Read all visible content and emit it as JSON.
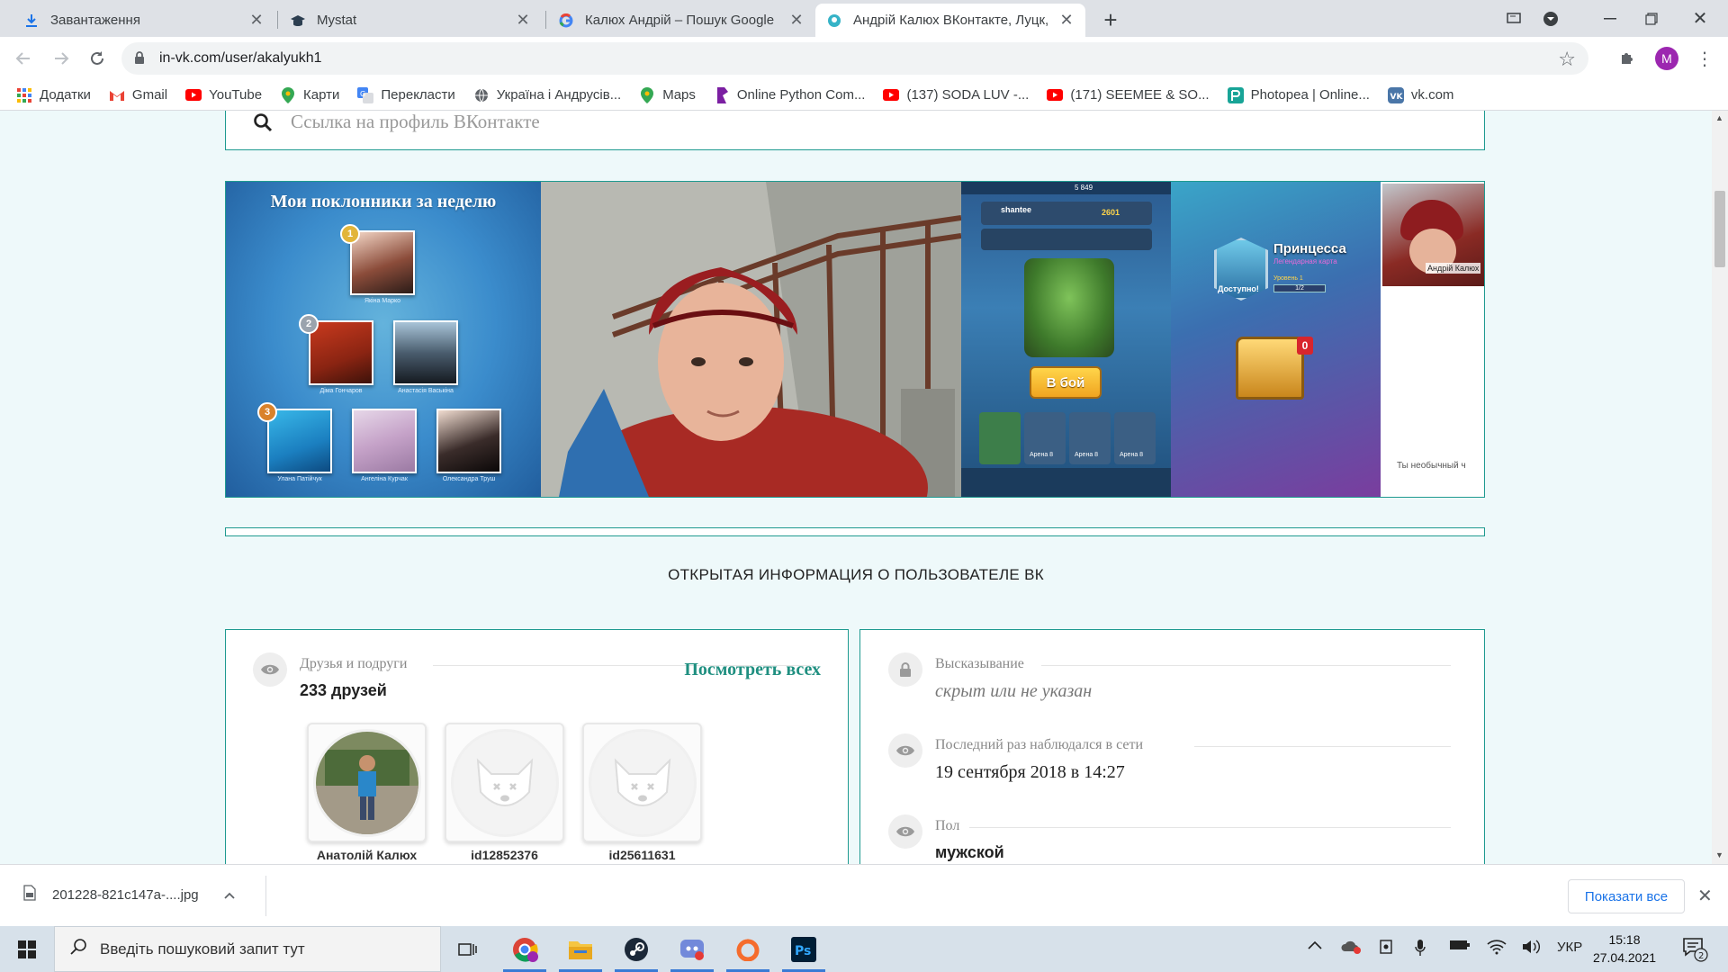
{
  "browser": {
    "tabs": [
      {
        "title": "Завантаження",
        "icon": "download-icon",
        "active": false
      },
      {
        "title": "Mystat",
        "icon": "graduation-cap-icon",
        "active": false
      },
      {
        "title": "Калюх Андрій – Пошук Google",
        "icon": "google-icon",
        "active": false
      },
      {
        "title": "Андрій Калюх ВКонтакте, Луцк,",
        "icon": "in-vk-icon",
        "active": true
      }
    ],
    "new_tab": "+",
    "url": "in-vk.com/user/akalyukh1",
    "profile_initial": "M",
    "bookmarks": [
      {
        "label": "Додатки",
        "icon": "apps-grid-icon"
      },
      {
        "label": "Gmail",
        "icon": "gmail-icon"
      },
      {
        "label": "YouTube",
        "icon": "youtube-icon"
      },
      {
        "label": "Карти",
        "icon": "maps-pin-icon"
      },
      {
        "label": "Перекласти",
        "icon": "translate-icon"
      },
      {
        "label": "Україна і Андрусів...",
        "icon": "globe-icon"
      },
      {
        "label": "Maps",
        "icon": "maps-pin-icon"
      },
      {
        "label": "Online Python Com...",
        "icon": "python-icon"
      },
      {
        "label": "(137) SODA LUV -...",
        "icon": "youtube-icon"
      },
      {
        "label": "(171) SEEMEE & SO...",
        "icon": "youtube-icon"
      },
      {
        "label": "Photopea | Online...",
        "icon": "photopea-icon"
      },
      {
        "label": "vk.com",
        "icon": "vk-icon"
      }
    ]
  },
  "page": {
    "search_placeholder": "Ссылка на профиль ВКонтакте",
    "gallery": {
      "fans_title": "Мои поклонники за неделю",
      "fans": [
        {
          "name": "Якіна Марко",
          "rank": "1"
        },
        {
          "name": "Діма Гончаров",
          "rank": "2"
        },
        {
          "name": "Анастасія Васькіна",
          "rank": ""
        },
        {
          "name": "Улана Патійчук",
          "rank": "3"
        },
        {
          "name": "Ангеліна Курчак",
          "rank": ""
        },
        {
          "name": "Олександра Труш",
          "rank": ""
        }
      ],
      "game_button": "В бой",
      "game_card_title": "Принцесса",
      "game_card_sub": "Легендарная карта",
      "game_card_badge": "Доступно!",
      "game_card_level": "Уровень 1",
      "game_chest_count": "0",
      "game_arena": "Арена 8",
      "game_gold": "5 849",
      "game_trophies": "2601",
      "game_player": "shantee",
      "game_level_bar": "1/2",
      "thumb_caption": "Андрій Калюх",
      "thumb_footer": "Ты необычный ч"
    },
    "section_title": "ОТКРЫТАЯ ИНФОРМАЦИЯ О ПОЛЬЗОВАТЕЛЕ ВК",
    "friends": {
      "label": "Друзья и подруги",
      "count": "233 друзей",
      "see_all": "Посмотреть всех",
      "list": [
        {
          "name": "Анатолій Калюх",
          "has_photo": true
        },
        {
          "name": "id12852376",
          "has_photo": false
        },
        {
          "name": "id25611631",
          "has_photo": false
        }
      ]
    },
    "info": [
      {
        "label": "Высказывание",
        "value": "скрыт или не указан",
        "icon": "lock-icon",
        "style": "italic"
      },
      {
        "label": "Последний раз наблюдался в сети",
        "value": "19 сентября 2018 в 14:27",
        "icon": "eye-icon",
        "style": "plain"
      },
      {
        "label": "Пол",
        "value": "мужской",
        "icon": "eye-icon",
        "style": "bold"
      }
    ]
  },
  "download_bar": {
    "file": "201228-821c147a-....jpg",
    "show_all": "Показати все"
  },
  "taskbar": {
    "search_placeholder": "Введіть пошуковий запит тут",
    "lang": "УКР",
    "time": "15:18",
    "date": "27.04.2021",
    "notif_count": "2"
  }
}
